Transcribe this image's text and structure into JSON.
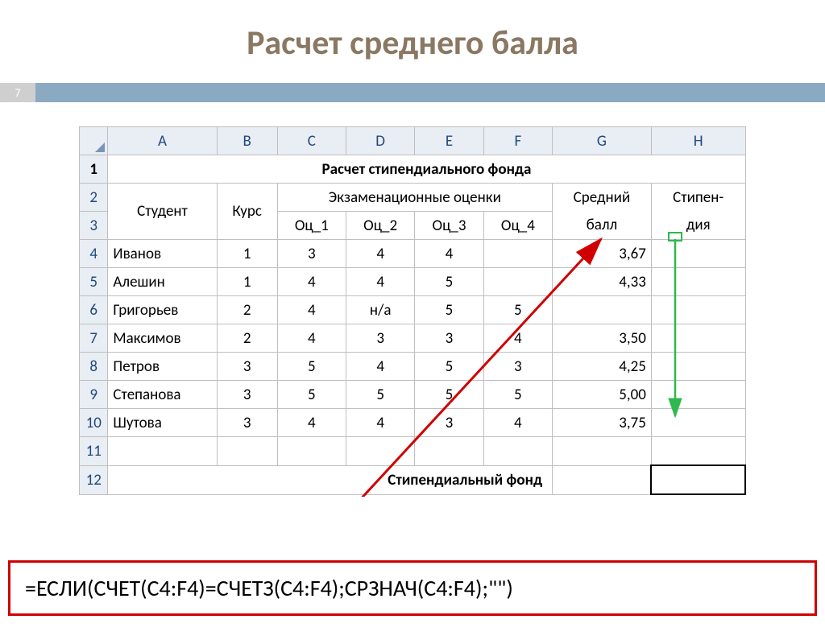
{
  "title": "Расчет среднего балла",
  "page_number": "7",
  "columns": [
    "A",
    "B",
    "C",
    "D",
    "E",
    "F",
    "G",
    "H"
  ],
  "rows": [
    "1",
    "2",
    "3",
    "4",
    "5",
    "6",
    "7",
    "8",
    "9",
    "10",
    "11",
    "12"
  ],
  "sheet_title": "Расчет стипендиального фонда",
  "headers": {
    "student": "Студент",
    "course": "Курс",
    "grades_group": "Экзаменационные оценки",
    "g1": "Оц_1",
    "g2": "Оц_2",
    "g3": "Оц_3",
    "g4": "Оц_4",
    "avg_top": "Средний",
    "avg_bot": "балл",
    "stip_top": "Стипен-",
    "stip_bot": "дия"
  },
  "data_rows": [
    {
      "name": "Иванов",
      "course": "1",
      "g1": "3",
      "g2": "4",
      "g3": "4",
      "g4": "",
      "avg": "3,67"
    },
    {
      "name": "Алешин",
      "course": "1",
      "g1": "4",
      "g2": "4",
      "g3": "5",
      "g4": "",
      "avg": "4,33"
    },
    {
      "name": "Григорьев",
      "course": "2",
      "g1": "4",
      "g2": "н/а",
      "g3": "5",
      "g4": "5",
      "avg": ""
    },
    {
      "name": "Максимов",
      "course": "2",
      "g1": "4",
      "g2": "3",
      "g3": "3",
      "g4": "4",
      "avg": "3,50"
    },
    {
      "name": "Петров",
      "course": "3",
      "g1": "5",
      "g2": "4",
      "g3": "5",
      "g4": "3",
      "avg": "4,25"
    },
    {
      "name": "Степанова",
      "course": "3",
      "g1": "5",
      "g2": "5",
      "g3": "5",
      "g4": "5",
      "avg": "5,00"
    },
    {
      "name": "Шутова",
      "course": "3",
      "g1": "4",
      "g2": "4",
      "g3": "3",
      "g4": "4",
      "avg": "3,75"
    }
  ],
  "footer_label": "Стипендиальный фонд",
  "formula": "=ЕСЛИ(СЧЕТ(С4:F4)=СЧЕТЗ(C4:F4);СРЗНАЧ(C4:F4);\"\")"
}
